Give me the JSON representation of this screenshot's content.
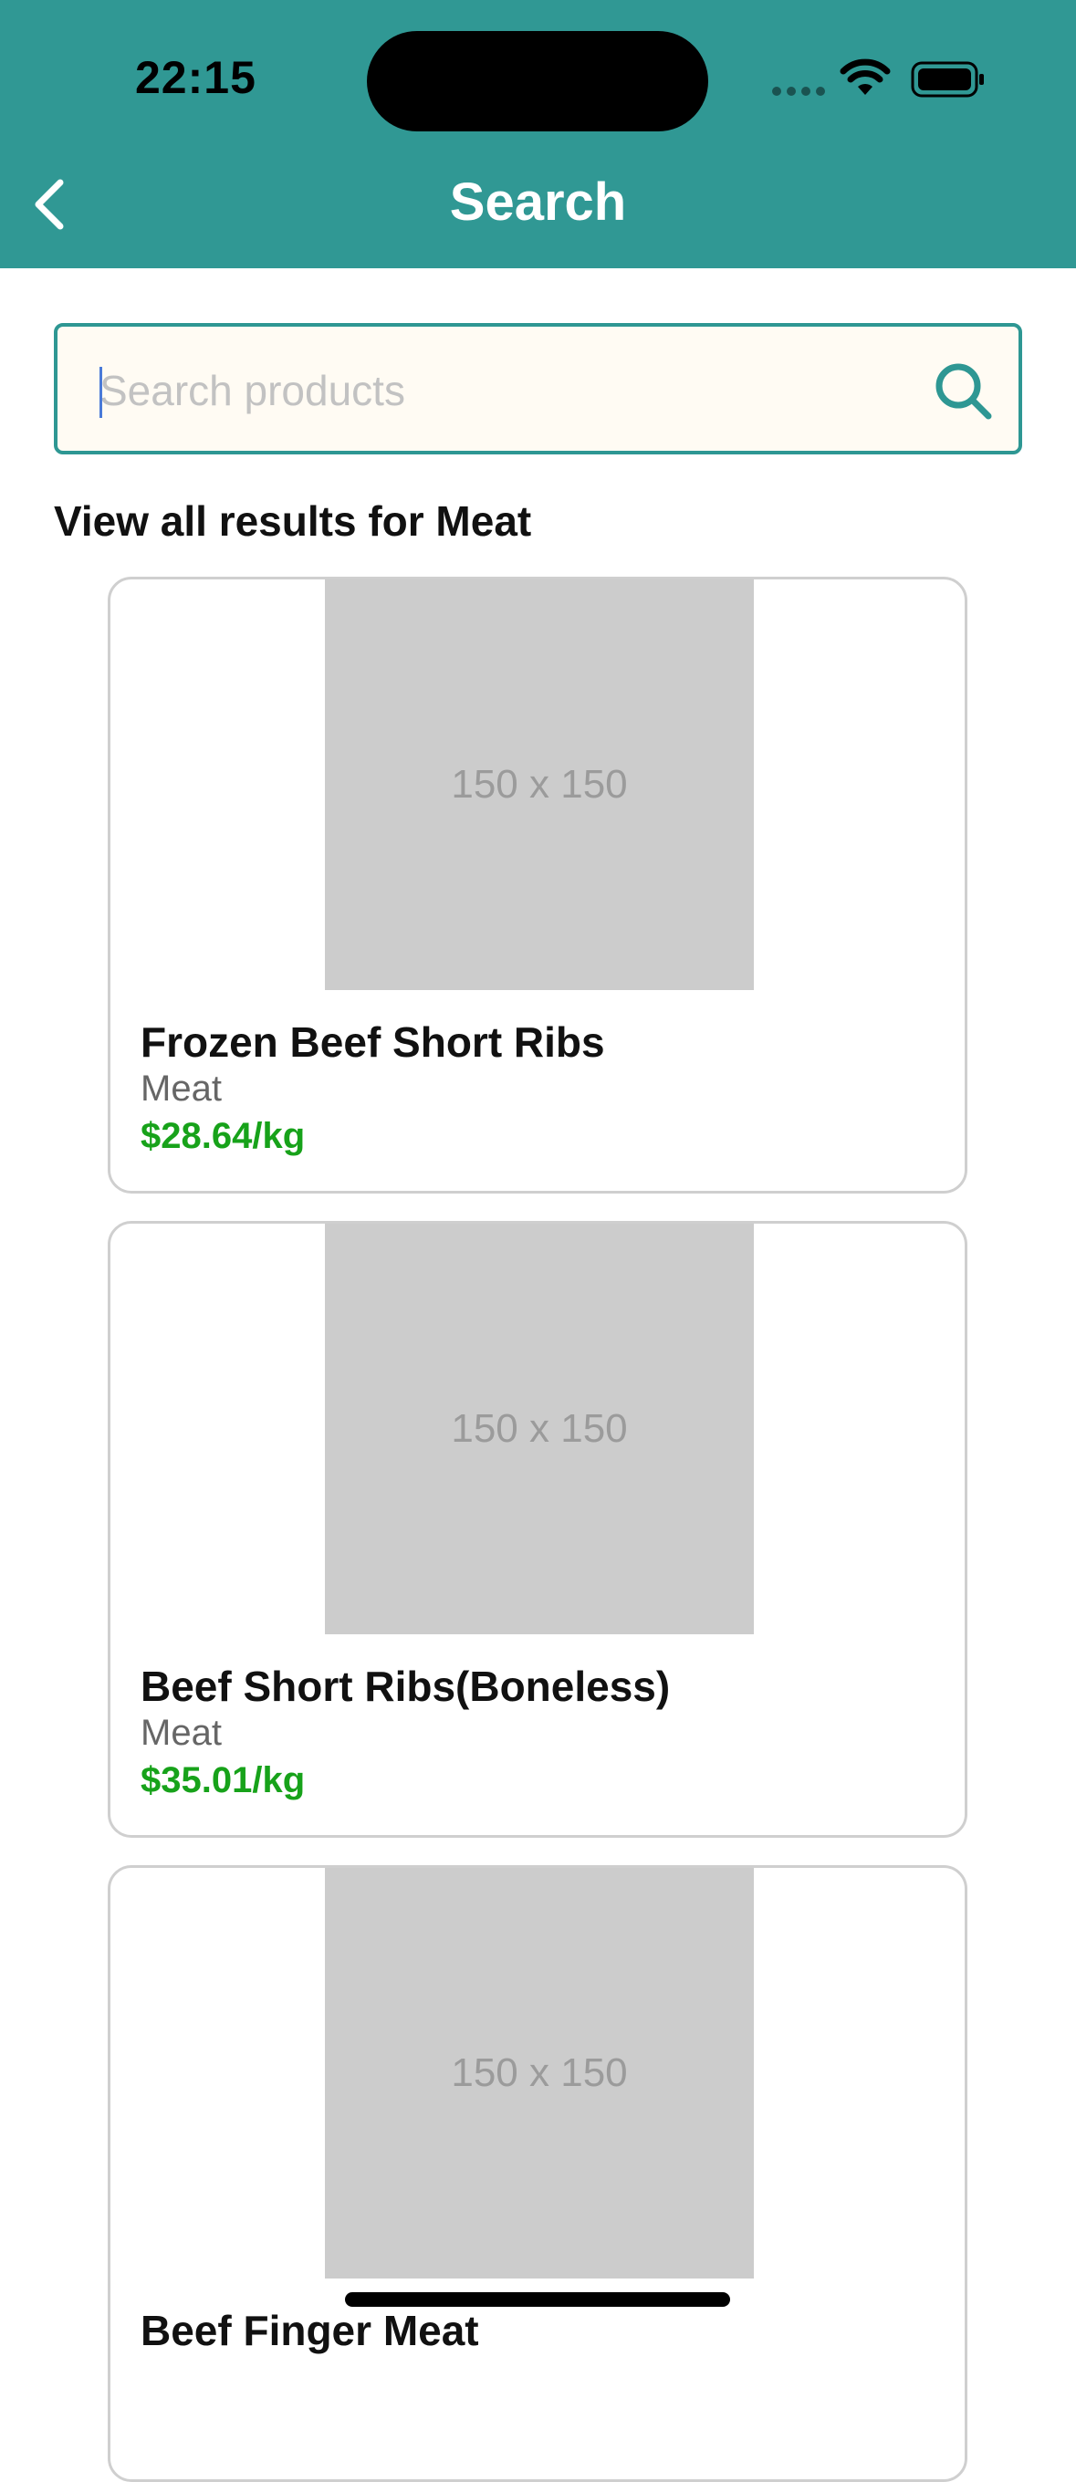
{
  "status_bar": {
    "time": "22:15"
  },
  "header": {
    "title": "Search"
  },
  "search": {
    "placeholder": "Search products",
    "value": ""
  },
  "results": {
    "heading": "View all results for Meat",
    "products": [
      {
        "image_label": "150 x 150",
        "name": "Frozen Beef Short Ribs",
        "category": "Meat",
        "price": "$28.64/kg"
      },
      {
        "image_label": "150 x 150",
        "name": "Beef Short Ribs(Boneless)",
        "category": "Meat",
        "price": "$35.01/kg"
      },
      {
        "image_label": "150 x 150",
        "name": "Beef Finger Meat",
        "category": "",
        "price": ""
      }
    ]
  },
  "colors": {
    "header_bg": "#309894",
    "accent": "#2e9793",
    "price": "#17a21a",
    "search_bg": "#fffbf3"
  },
  "icons": {
    "back": "chevron-left-icon",
    "search": "magnifier-icon",
    "wifi": "wifi-icon",
    "battery": "battery-icon",
    "signal": "signal-dots-icon"
  }
}
